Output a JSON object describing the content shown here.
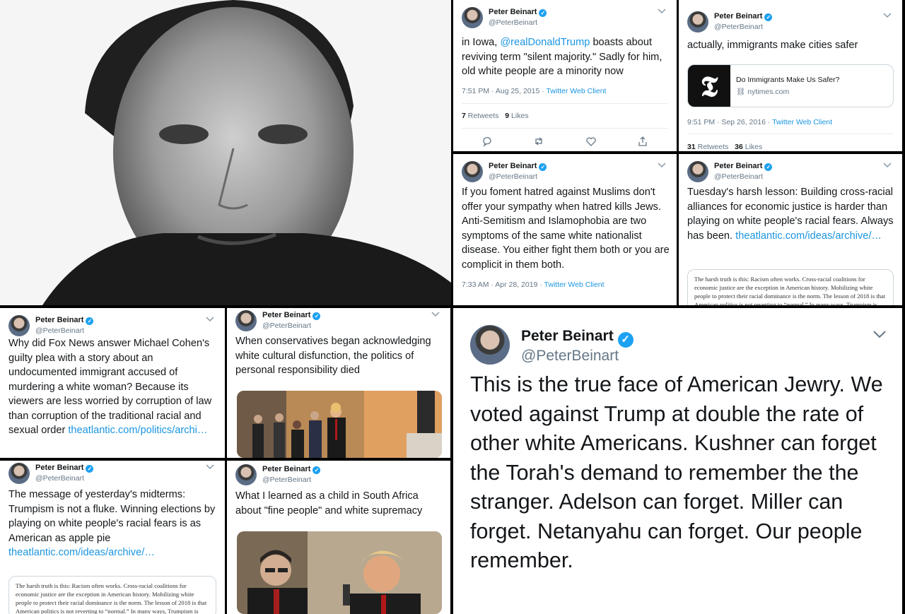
{
  "author": {
    "name": "Peter Beinart",
    "handle": "@PeterBeinart"
  },
  "tweets": {
    "iowa": {
      "pre": "in Iowa, ",
      "mention": "@realDonaldTrump",
      "post": " boasts about reviving term \"silent majority.\" Sadly for him, old white people are a minority now",
      "time": "7:51 PM · Aug 25, 2015 · ",
      "client": "Twitter Web Client",
      "retweets": "7",
      "retweets_label": " Retweets",
      "likes": "9",
      "likes_label": " Likes"
    },
    "immigrants": {
      "text": "actually, immigrants make cities safer",
      "card_title": "Do Immigrants Make Us Safer?",
      "card_domain": "nytimes.com",
      "card_logo": "𝕿",
      "time": "9:51 PM · Sep 26, 2016 · ",
      "client": "Twitter Web Client",
      "retweets": "31",
      "retweets_label": " Retweets",
      "likes": "36",
      "likes_label": " Likes"
    },
    "foment": {
      "text": "If you foment hatred against Muslims don't offer your sympathy when hatred kills Jews. Anti-Semitism and Islamophobia are two symptoms of the same white nationalist disease. You either fight them both or you are complicit in them both.",
      "time": "7:33 AM · Apr 28, 2019 · ",
      "client": "Twitter Web Client"
    },
    "tuesday": {
      "text": "Tuesday's harsh lesson: Building cross-racial alliances for economic justice is harder than playing on white people's racial fears. Always has been.",
      "link": "theatlantic.com/ideas/archive/…",
      "excerpt": "The harsh truth is this: Racism often works. Cross-racial coalitions for economic justice are the exception in American history. Mobilizing white people to protect their racial dominance is the norm. The lesson of 2018 is that American politics is not reverting to “normal.” In many ways, Trumpism is"
    },
    "foxnews": {
      "text": "Why did Fox News answer Michael Cohen's guilty plea with a story about an undocumented immigrant accused of murdering a white woman? Because its viewers are less worried by corruption of law than corruption of the traditional racial and sexual order",
      "link": "theatlantic.com/politics/archi…"
    },
    "conservatives": {
      "text": "When conservatives began acknowledging white cultural disfunction, the politics of personal responsibility died"
    },
    "midterms": {
      "text": "The message of yesterday's midterms: Trumpism is not a fluke. Winning elections by playing on white people's racial fears is as American as apple pie",
      "link": "theatlantic.com/ideas/archive/…",
      "excerpt": "The harsh truth is this: Racism often works. Cross-racial coalitions for economic justice are the exception in American history. Mobilizing white people to protect their racial dominance is the norm. The lesson of 2018 is that American politics is not reverting to “normal.” In many ways, Trumpism is"
    },
    "southafrica": {
      "text": "What I learned as a child in South Africa about \"fine people\" and white supremacy"
    },
    "jewry": {
      "text": "This is the true face of American Jewry. We voted against Trump at double the rate of other white Americans. Kushner can forget the Torah's demand to remember the the stranger. Adelson can forget. Miller can forget. Netanyahu can forget. Our people remember."
    }
  },
  "icons": [
    "chevron-down-icon",
    "verified-badge-icon",
    "reply-icon",
    "retweet-icon",
    "like-icon",
    "share-icon",
    "link-icon"
  ],
  "colors": {
    "link": "#1b95e0",
    "verified": "#1da1f2",
    "meta": "#657786",
    "text": "#14171a"
  }
}
